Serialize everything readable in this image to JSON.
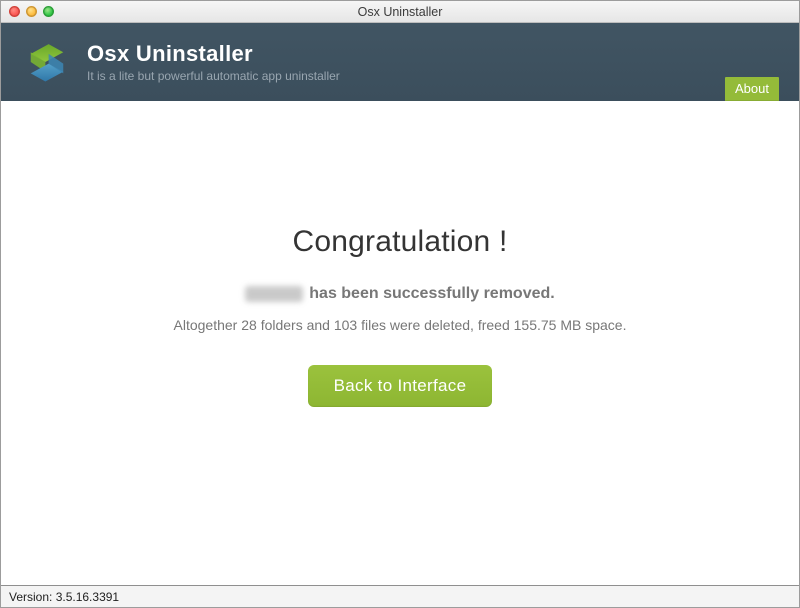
{
  "window": {
    "title": "Osx Uninstaller"
  },
  "header": {
    "app_title": "Osx Uninstaller",
    "app_subtitle": "It is a lite but powerful automatic app uninstaller",
    "about_label": "About"
  },
  "main": {
    "congratulation": "Congratulation !",
    "removed_app_visible": false,
    "removed_suffix": "has been successfully removed.",
    "stats_text": "Altogether 28 folders and 103 files were deleted, freed 155.75 MB space.",
    "back_label": "Back to Interface"
  },
  "footer": {
    "version_text": "Version: 3.5.16.3391"
  },
  "colors": {
    "accent": "#94bb39",
    "header_bg": "#3f5361"
  }
}
